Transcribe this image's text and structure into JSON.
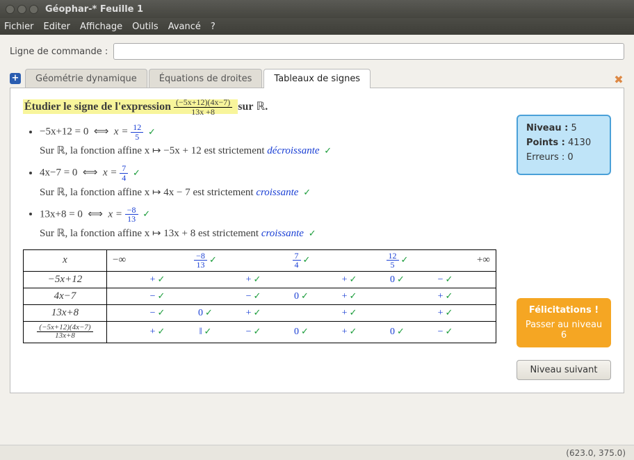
{
  "window": {
    "title": "Géophar-* Feuille 1"
  },
  "menu": [
    "Fichier",
    "Editer",
    "Affichage",
    "Outils",
    "Avancé",
    "?"
  ],
  "cmd": {
    "label": "Ligne de commande :",
    "value": ""
  },
  "tabs": [
    {
      "label": "Géométrie dynamique",
      "active": false
    },
    {
      "label": "Équations de droites",
      "active": false
    },
    {
      "label": "Tableaux de signes",
      "active": true
    }
  ],
  "problem": {
    "prefix": "Étudier le signe de l'expression",
    "num": "(−5x+12)(4x−7)",
    "den": "13x +8",
    "suffix_sur": "sur",
    "set": "ℝ"
  },
  "steps": [
    {
      "eq_lhs": "−5x+12 = 0",
      "iff": "⟺",
      "x_eq": "x =",
      "sol_n": "12",
      "sol_d": "5",
      "desc_pre": "Sur ℝ, la fonction affine x ↦ −5x + 12 est strictement",
      "desc_adj": "décroissante"
    },
    {
      "eq_lhs": "4x−7 = 0",
      "iff": "⟺",
      "x_eq": "x =",
      "sol_n": "7",
      "sol_d": "4",
      "desc_pre": "Sur ℝ, la fonction affine x ↦ 4x − 7 est strictement",
      "desc_adj": "croissante"
    },
    {
      "eq_lhs": "13x+8 = 0",
      "iff": "⟺",
      "x_eq": "x =",
      "sol_n": "−8",
      "sol_d": "13",
      "desc_pre": "Sur ℝ, la fonction affine x ↦ 13x + 8 est strictement",
      "desc_adj": "croissante"
    }
  ],
  "table": {
    "var": "x",
    "minf": "−∞",
    "pinf": "+∞",
    "breaks": [
      {
        "n": "−8",
        "d": "13"
      },
      {
        "n": "7",
        "d": "4"
      },
      {
        "n": "12",
        "d": "5"
      }
    ],
    "rows": [
      {
        "label": "−5x+12",
        "cells": [
          "+",
          "+",
          "+",
          "0",
          "−"
        ]
      },
      {
        "label": "4x−7",
        "cells": [
          "−",
          "−",
          "0",
          "+",
          "+"
        ]
      },
      {
        "label": "13x+8",
        "cells": [
          "−",
          "0",
          "+",
          "+",
          "+"
        ]
      },
      {
        "label_frac": {
          "n": "(−5x+12)(4x−7)",
          "d": "13x+8"
        },
        "cells": [
          "+",
          "‖",
          "−",
          "0",
          "+",
          "0",
          "−"
        ]
      }
    ]
  },
  "info": {
    "level_label": "Niveau :",
    "level": "5",
    "points_label": "Points :",
    "points": "4130",
    "errors_label": "Erreurs :",
    "errors": "0"
  },
  "congrats": {
    "title": "Félicitations !",
    "text": "Passer au niveau 6"
  },
  "next_btn": "Niveau suivant",
  "status": "(623.0, 375.0)"
}
